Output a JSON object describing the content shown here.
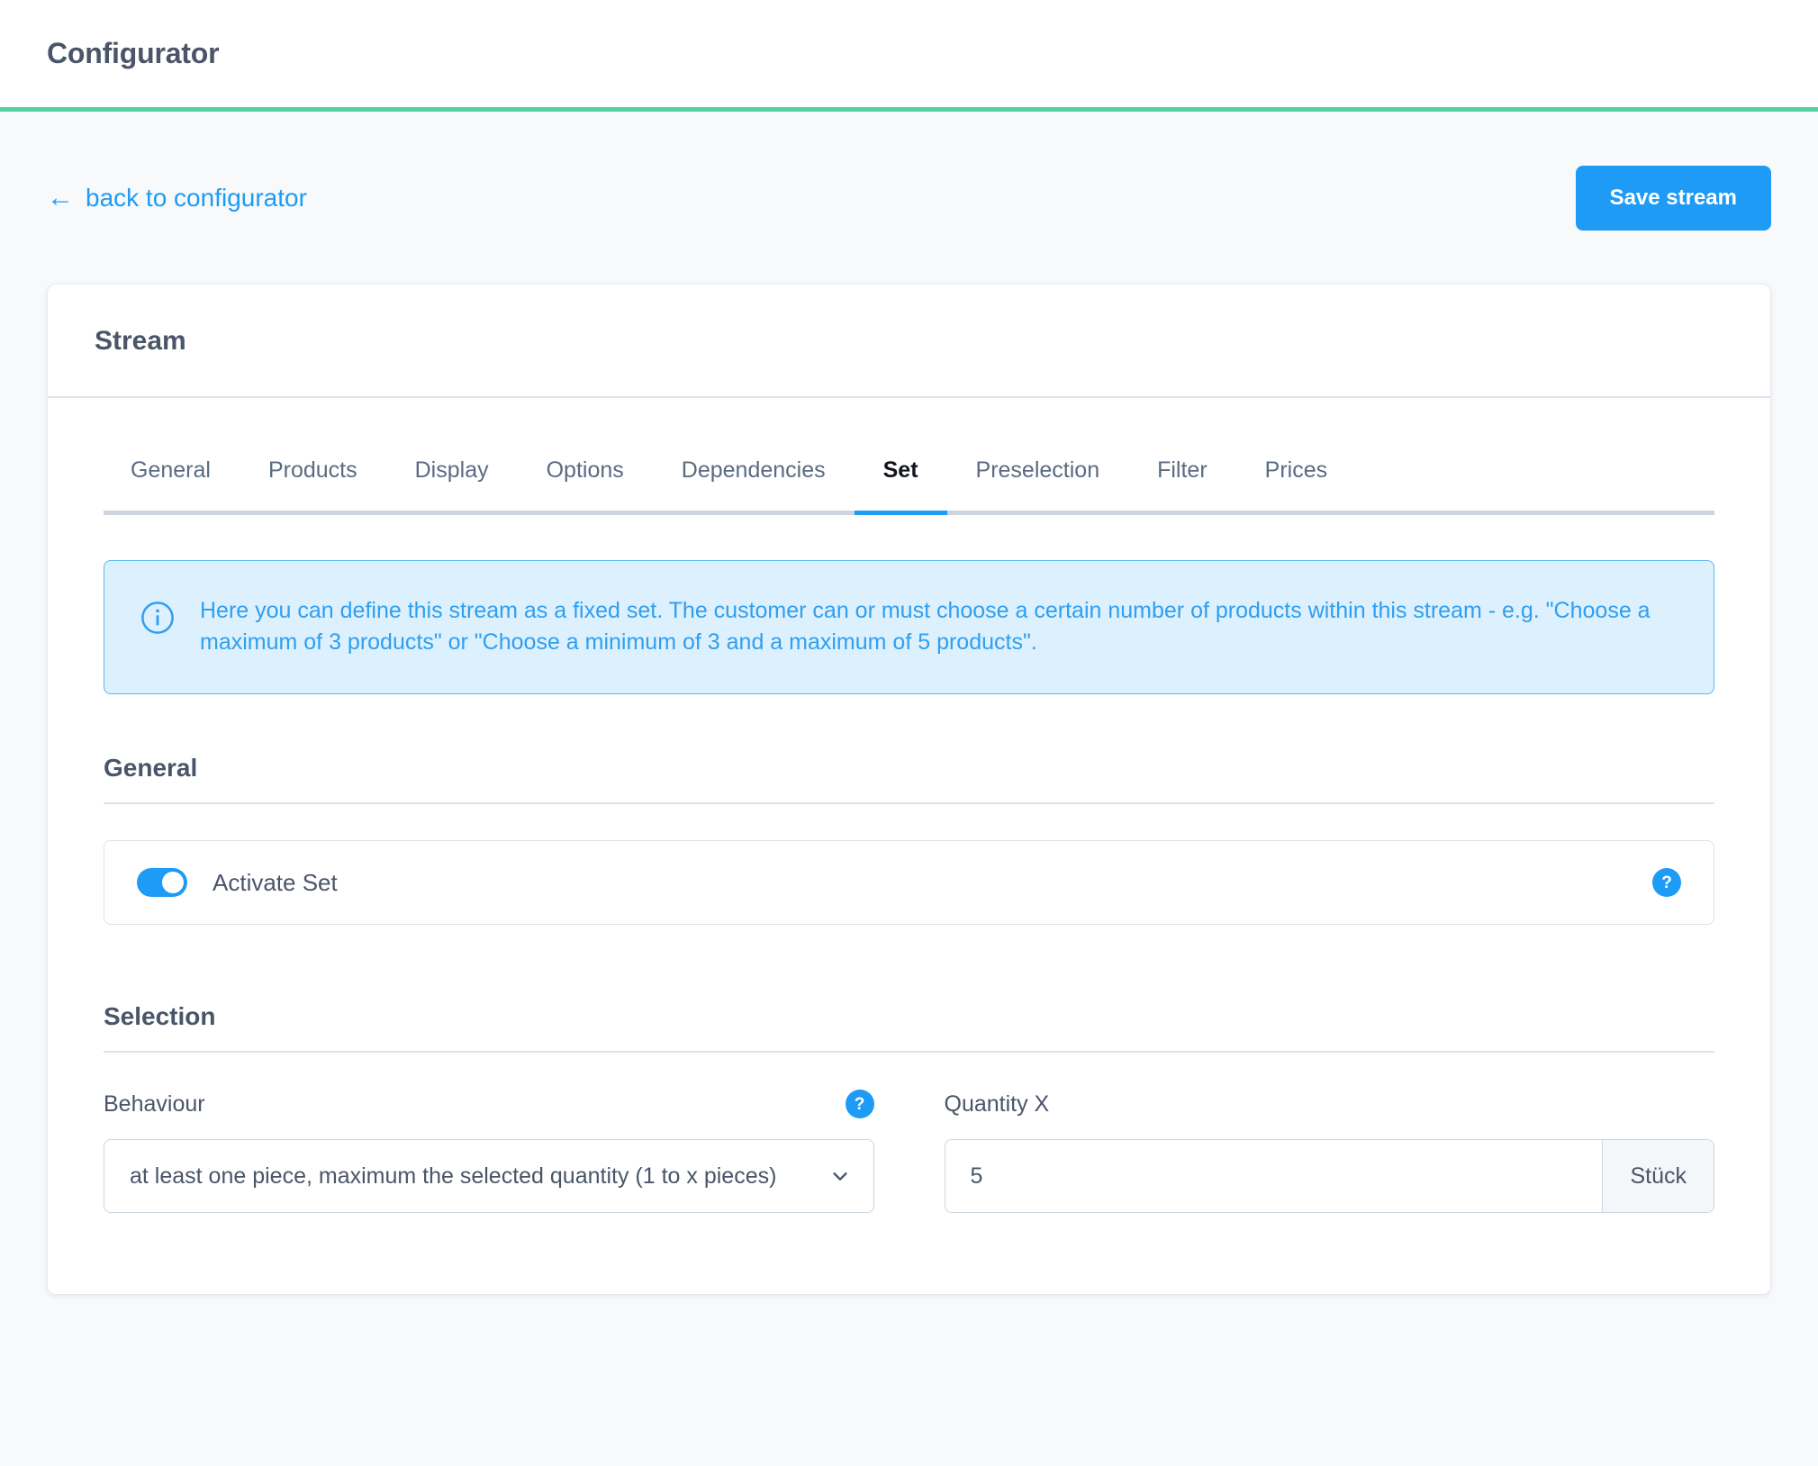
{
  "header": {
    "title": "Configurator",
    "accent_color": "#52d2a0"
  },
  "action_bar": {
    "back_link": "back to configurator",
    "back_arrow": "←",
    "save_button": "Save stream"
  },
  "card": {
    "title": "Stream"
  },
  "tabs": [
    {
      "label": "General",
      "active": false
    },
    {
      "label": "Products",
      "active": false
    },
    {
      "label": "Display",
      "active": false
    },
    {
      "label": "Options",
      "active": false
    },
    {
      "label": "Dependencies",
      "active": false
    },
    {
      "label": "Set",
      "active": true
    },
    {
      "label": "Preselection",
      "active": false
    },
    {
      "label": "Filter",
      "active": false
    },
    {
      "label": "Prices",
      "active": false
    }
  ],
  "alert": {
    "icon": "info-icon",
    "text": "Here you can define this stream as a fixed set. The customer can or must choose a certain number of products within this stream - e.g. \"Choose a maximum of 3 products\" or \"Choose a minimum of 3 and a maximum of 5 products\".",
    "accent_color": "#2f9ff0",
    "background_color": "#ddf0fd"
  },
  "general_section": {
    "title": "General",
    "activate_set": {
      "label": "Activate Set",
      "enabled": true,
      "help": "?"
    }
  },
  "selection_section": {
    "title": "Selection",
    "behaviour": {
      "label": "Behaviour",
      "help": "?",
      "value": "at least one piece, maximum the selected quantity (1 to x pieces)"
    },
    "quantity": {
      "label": "Quantity X",
      "value": "5",
      "placeholder": "",
      "unit": "Stück"
    }
  },
  "colors": {
    "primary": "#1e9bf5",
    "green_accent": "#52d2a0",
    "text": "#4a5568"
  }
}
